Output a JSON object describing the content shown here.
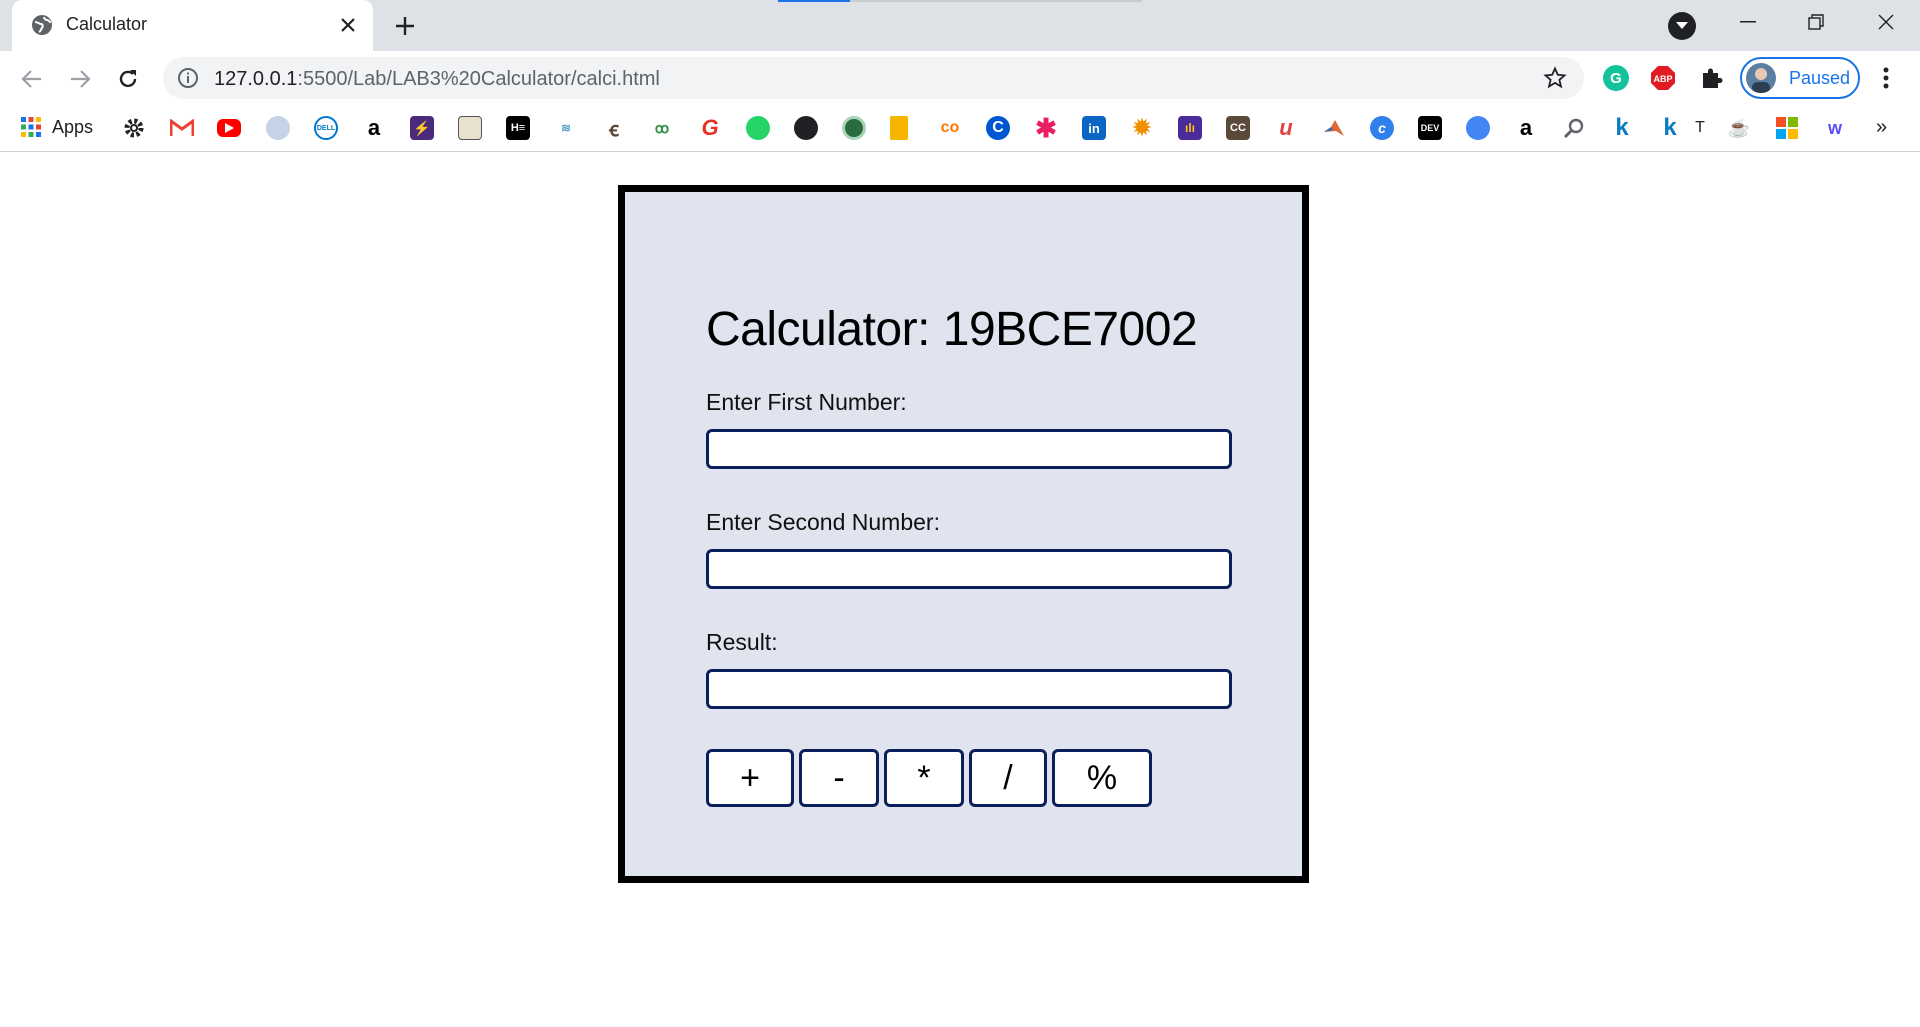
{
  "browser": {
    "tab": {
      "title": "Calculator",
      "favicon": "globe-icon"
    },
    "address": {
      "host": "127.0.0.1",
      "path": ":5500/Lab/LAB3%20Calculator/calci.html"
    },
    "profile": {
      "label": "Paused"
    },
    "bookmarks": {
      "apps_label": "Apps",
      "items": [
        "gear-icon",
        "gmail-icon",
        "youtube-icon",
        "ship-icon",
        "dell-icon",
        "amazon-icon",
        "bolt-icon",
        "image-icon",
        "hackerearth-icon",
        "wave-icon",
        "codechef-icon",
        "geeksforgeeks-icon",
        "g-icon",
        "whatsapp-icon",
        "github-icon",
        "circle-icon",
        "stack-icon",
        "coursera-icon",
        "c-icon",
        "asterisk-icon",
        "linkedin-icon",
        "bug-icon",
        "chart-icon",
        "cc-icon",
        "u-icon",
        "matlab-icon",
        "c2-icon",
        "dev-icon",
        "record-icon",
        "amazon2-icon",
        "search-icon",
        "k-icon",
        "k2-icon",
        "t-icon",
        "coffee-icon",
        "microsoft-icon",
        "w-icon"
      ],
      "t_label": "T",
      "more": "»"
    }
  },
  "calculator": {
    "title": "Calculator: 19BCE7002",
    "first_label": "Enter First Number:",
    "first_value": "",
    "second_label": "Enter Second Number:",
    "second_value": "",
    "result_label": "Result:",
    "result_value": "",
    "operators": [
      "+",
      "-",
      "*",
      "/",
      "%"
    ]
  },
  "colors": {
    "panel_bg": "#dfe4ef",
    "input_border": "#0a1f5c",
    "accent": "#1a73e8"
  }
}
